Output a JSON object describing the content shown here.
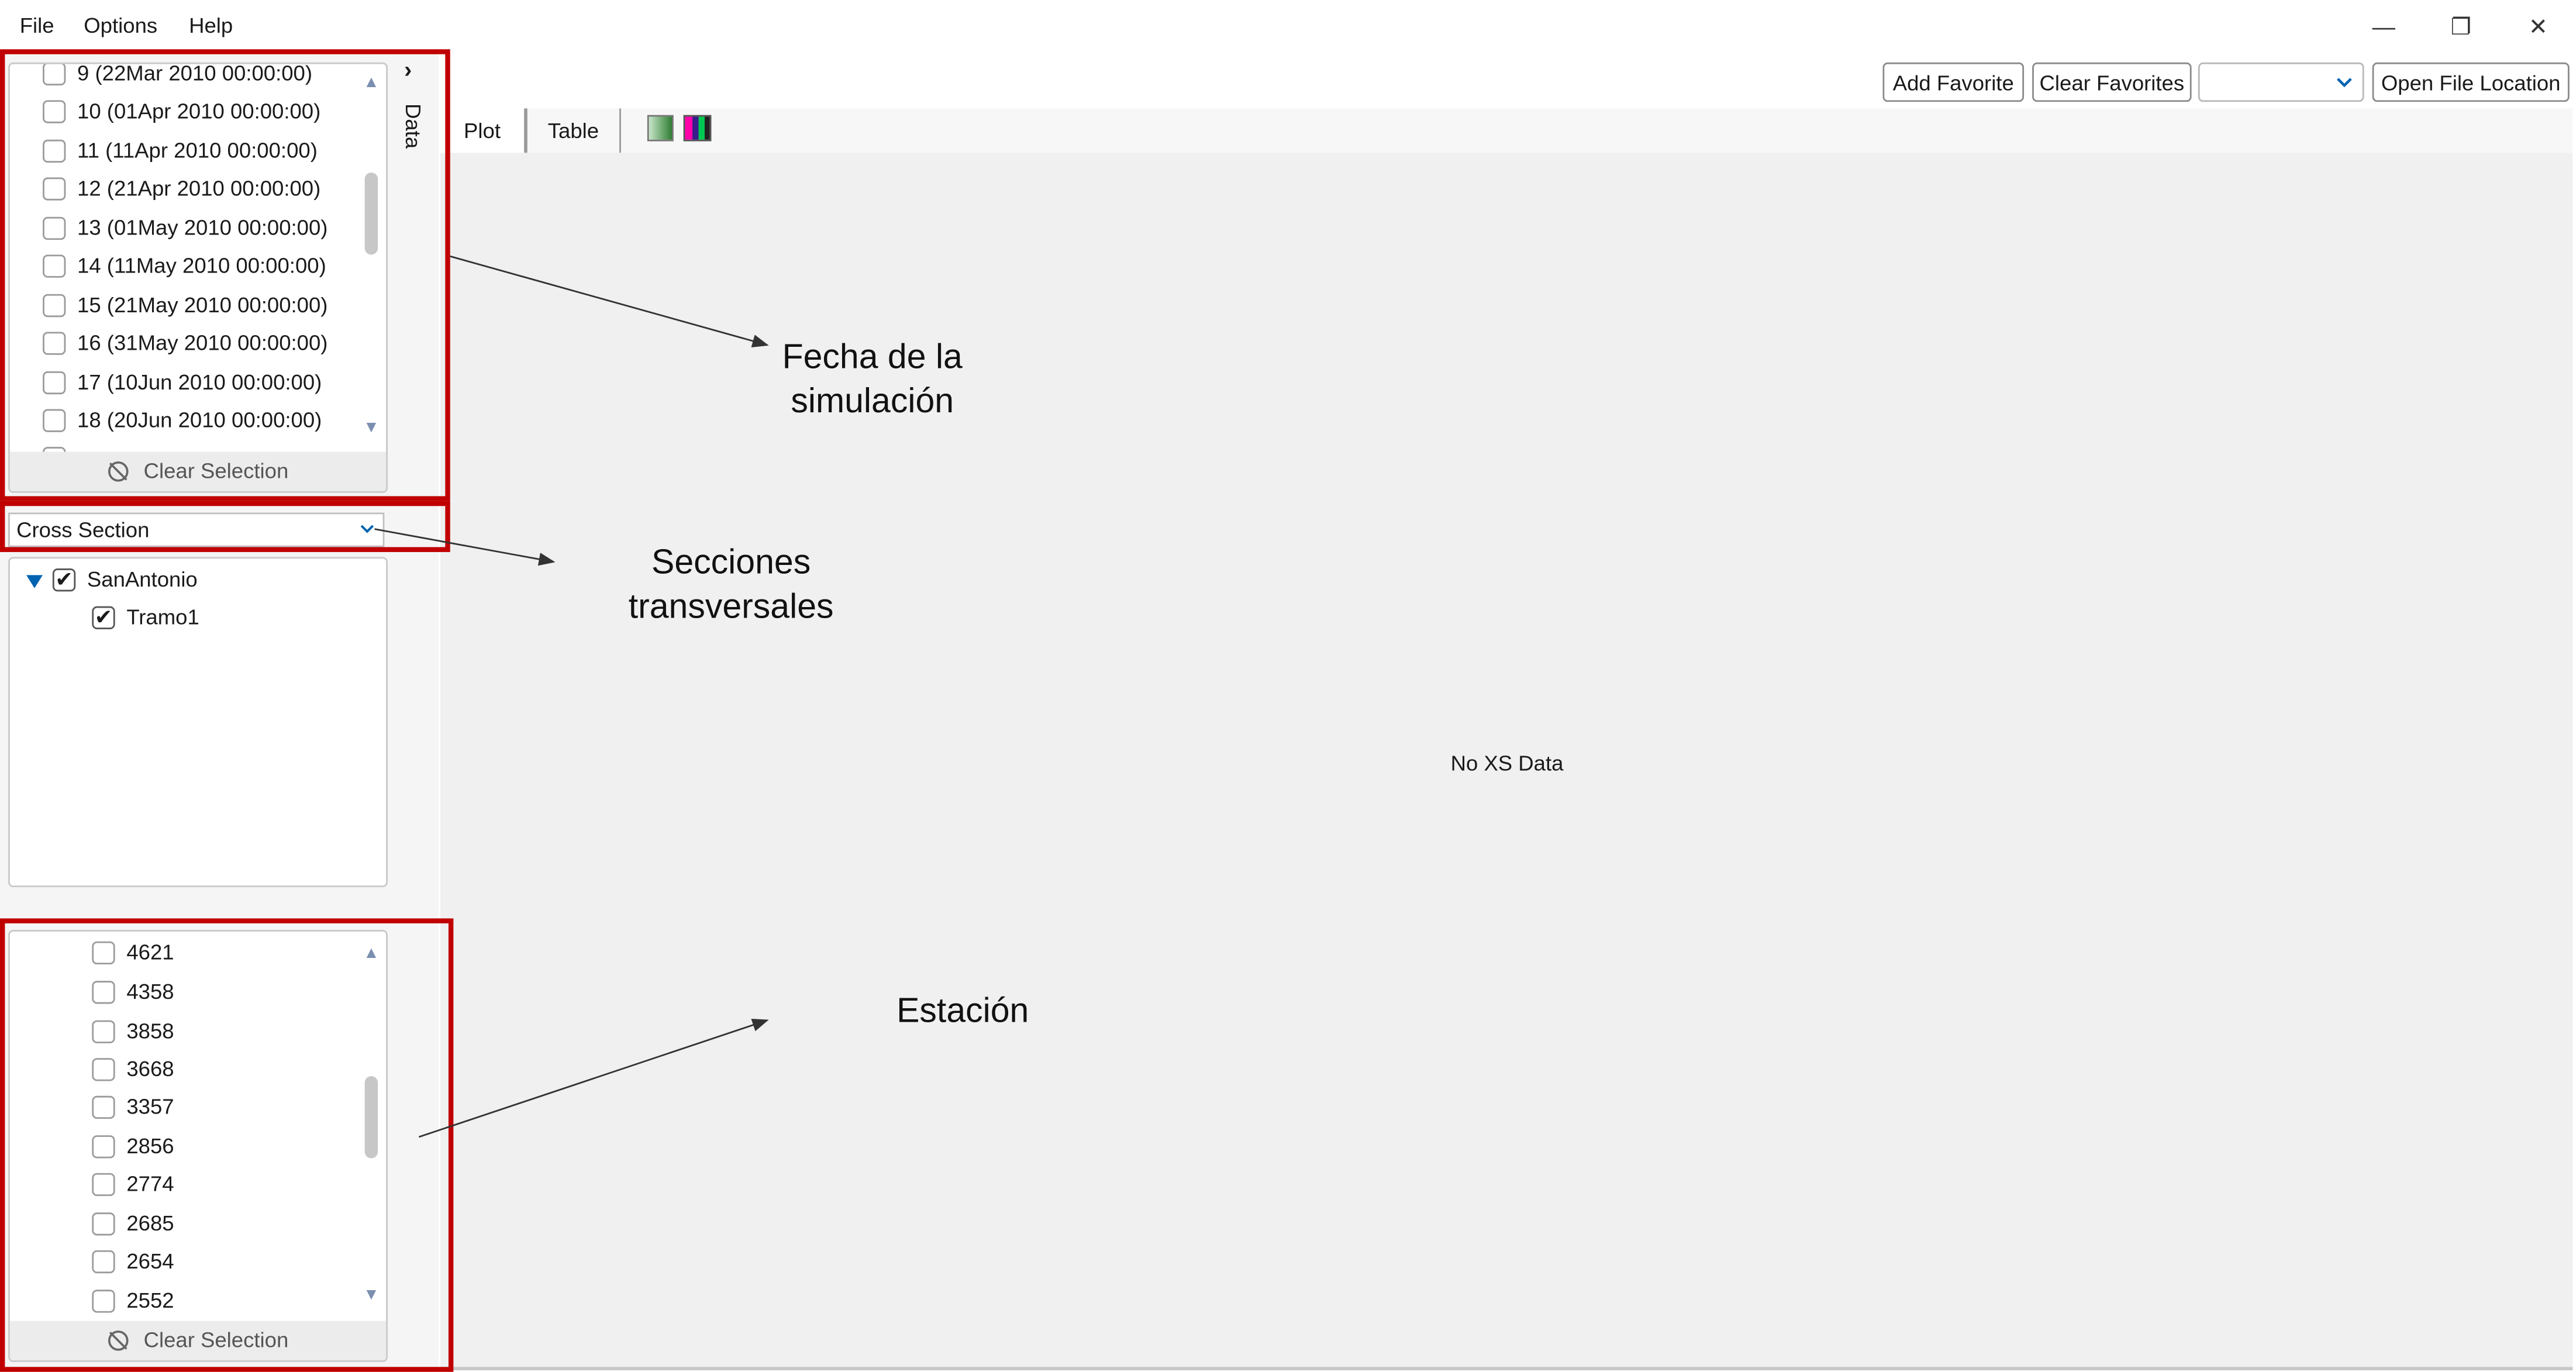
{
  "menu": {
    "file": "File",
    "options": "Options",
    "help": "Help"
  },
  "window_controls": {
    "minimize": "—",
    "restore": "❐",
    "close": "✕"
  },
  "toolbar": {
    "add_favorite": "Add Favorite",
    "clear_favorites": "Clear Favorites",
    "favorites_dropdown_value": "",
    "open_file_location": "Open File Location"
  },
  "tabs": {
    "plot": "Plot",
    "table": "Table"
  },
  "side_panel": {
    "collapse_arrow": "›",
    "data_label": "Data"
  },
  "dates_list": {
    "items": [
      "9 (22Mar 2010 00:00:00)",
      "10 (01Apr 2010 00:00:00)",
      "11 (11Apr 2010 00:00:00)",
      "12 (21Apr 2010 00:00:00)",
      "13 (01May 2010 00:00:00)",
      "14 (11May 2010 00:00:00)",
      "15 (21May 2010 00:00:00)",
      "16 (31May 2010 00:00:00)",
      "17 (10Jun 2010 00:00:00)",
      "18 (20Jun 2010 00:00:00)"
    ],
    "clear_label": "Clear Selection"
  },
  "cross_section": {
    "combo_value": "Cross Section",
    "tree_root": "SanAntonio",
    "tree_child": "Tramo1"
  },
  "stations_list": {
    "items": [
      "4621",
      "4358",
      "3858",
      "3668",
      "3357",
      "2856",
      "2774",
      "2685",
      "2654",
      "2552"
    ],
    "clear_label": "Clear Selection"
  },
  "plot": {
    "empty_message": "No XS Data"
  },
  "annotations": {
    "fecha_line1": "Fecha de la",
    "fecha_line2": "simulación",
    "secciones_line1": "Secciones",
    "secciones_line2": "transversales",
    "estacion": "Estación"
  },
  "colors": {
    "highlight_box": "#c00000",
    "tree_arrow": "#0063b1"
  }
}
